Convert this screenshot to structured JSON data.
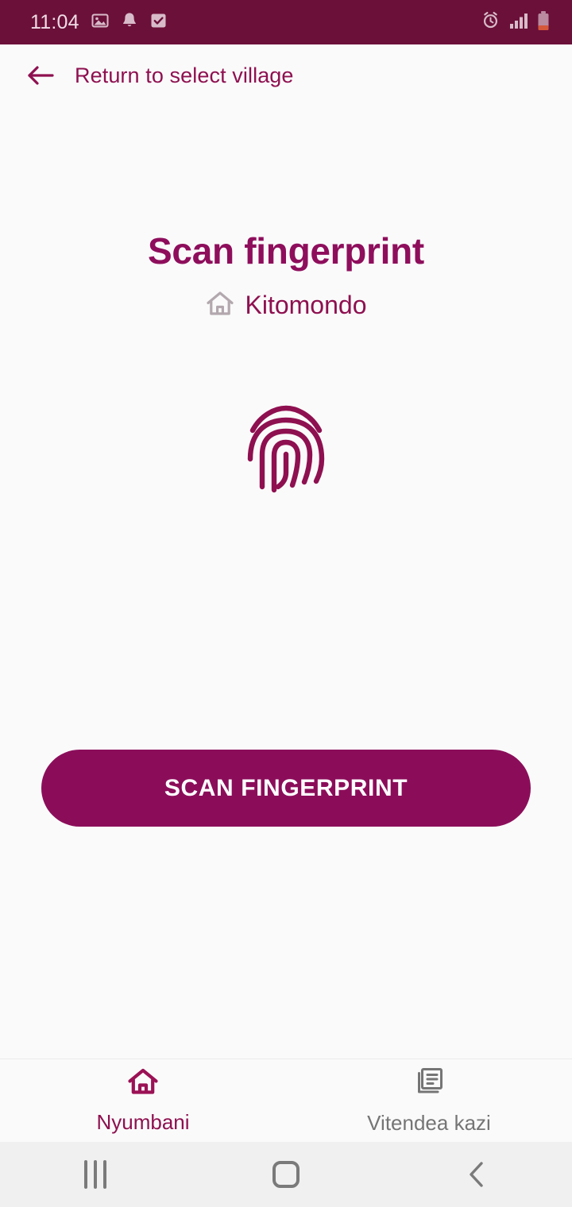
{
  "status_bar": {
    "time": "11:04",
    "background_color": "#6B1039",
    "text_color": "#EFDCE5",
    "left_icons": [
      "image-icon",
      "bell-icon",
      "checkbox-icon"
    ],
    "right_icons": [
      "alarm-icon",
      "signal-icon",
      "battery-low-icon"
    ]
  },
  "app_bar": {
    "back_icon": "arrow-left-icon",
    "title": "Return to select village",
    "title_color": "#8E1050"
  },
  "main": {
    "headline": "Scan fingerprint",
    "headline_color": "#8E0E5C",
    "village_icon": "home-icon",
    "village_name": "Kitomondo",
    "fingerprint_icon": "fingerprint-icon",
    "fingerprint_color": "#8E1050",
    "scan_button_label": "SCAN FINGERPRINT",
    "scan_button_color": "#8B0D5A",
    "scan_button_text_color": "#FFFFFF",
    "background_color": "#FAFAFA"
  },
  "bottom_nav": {
    "items": [
      {
        "label": "Nyumbani",
        "icon": "home-icon",
        "active": true,
        "color": "#8E1050"
      },
      {
        "label": "Vitendea kazi",
        "icon": "articles-icon",
        "active": false,
        "color": "#757575"
      }
    ]
  },
  "system_nav": {
    "background_color": "#F0F0F0",
    "buttons": [
      "recents-icon",
      "home-icon",
      "back-icon"
    ]
  }
}
